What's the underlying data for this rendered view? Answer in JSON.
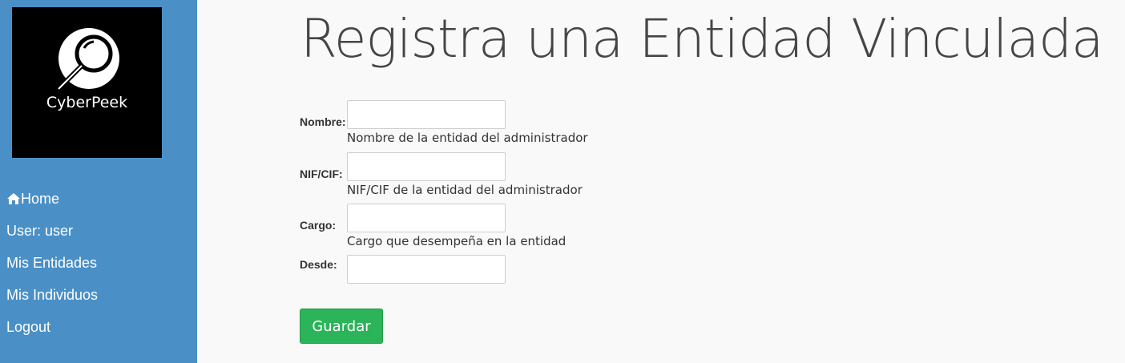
{
  "brand": {
    "name": "CyberPeek"
  },
  "nav": {
    "items": [
      {
        "label": "Home",
        "icon": "home-icon"
      },
      {
        "label": "User: user"
      },
      {
        "label": "Mis Entidades"
      },
      {
        "label": "Mis Individuos"
      },
      {
        "label": "Logout"
      }
    ]
  },
  "page": {
    "title": "Registra una Entidad Vinculada"
  },
  "form": {
    "nombre": {
      "label": "Nombre:",
      "value": "",
      "help": "Nombre de la entidad del administrador"
    },
    "nif": {
      "label": "NIF/CIF:",
      "value": "",
      "help": "NIF/CIF de la entidad del administrador"
    },
    "cargo": {
      "label": "Cargo:",
      "value": "",
      "help": "Cargo que desempeña en la entidad"
    },
    "desde": {
      "label": "Desde:",
      "value": ""
    },
    "submit_label": "Guardar"
  },
  "colors": {
    "sidebar": "#4a90c6",
    "button": "#2bb45a",
    "logo_bg": "#000000"
  }
}
